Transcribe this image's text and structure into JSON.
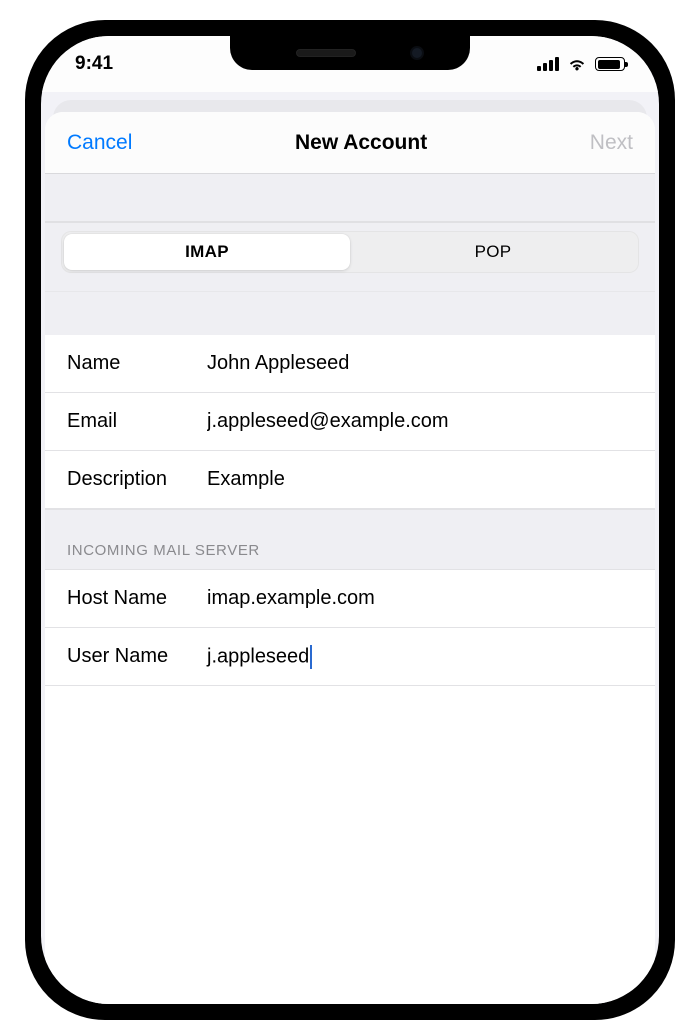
{
  "status": {
    "time": "9:41"
  },
  "nav": {
    "cancel": "Cancel",
    "title": "New Account",
    "next": "Next"
  },
  "segments": {
    "imap": "IMAP",
    "pop": "POP",
    "active": "imap"
  },
  "account": {
    "name_label": "Name",
    "name_value": "John Appleseed",
    "email_label": "Email",
    "email_value": "j.appleseed@example.com",
    "description_label": "Description",
    "description_value": "Example"
  },
  "incoming": {
    "header": "INCOMING MAIL SERVER",
    "host_label": "Host Name",
    "host_value": "imap.example.com",
    "user_label": "User Name",
    "user_value": "j.appleseed"
  }
}
